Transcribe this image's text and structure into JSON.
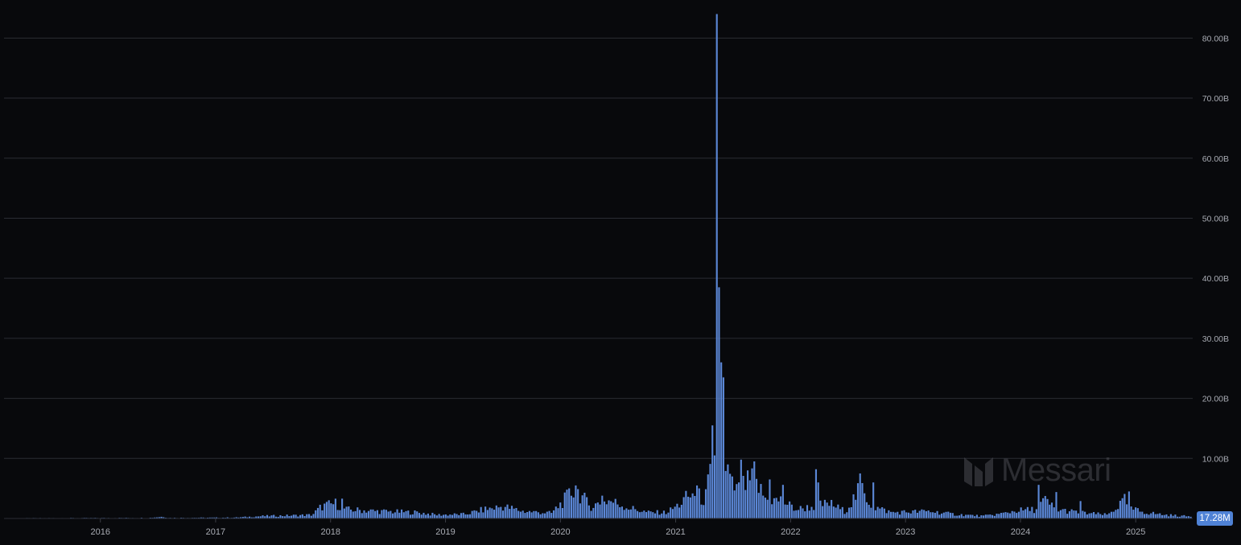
{
  "watermark": {
    "text": "Messari",
    "icon": "messari-logo-icon"
  },
  "last_value_label": "17.28M",
  "colors": {
    "background": "#08090c",
    "bar": "#5b87d6",
    "grid": "#2a2c33",
    "axis_text": "#a9acb4",
    "badge": "#4f82d6"
  },
  "chart_data": {
    "type": "bar",
    "title": "",
    "xlabel": "",
    "ylabel": "",
    "ylim": [
      0,
      85000000000
    ],
    "y_ticks": [
      10000000000,
      20000000000,
      30000000000,
      40000000000,
      50000000000,
      60000000000,
      70000000000,
      80000000000
    ],
    "y_tick_labels": [
      "10.00B",
      "20.00B",
      "30.00B",
      "40.00B",
      "50.00B",
      "60.00B",
      "70.00B",
      "80.00B"
    ],
    "x_range": [
      "2015-03-01",
      "2025-07-01"
    ],
    "x_ticks": [
      "2016-01-01",
      "2017-01-01",
      "2018-01-01",
      "2019-01-01",
      "2020-01-01",
      "2021-01-01",
      "2022-01-01",
      "2023-01-01",
      "2024-01-01",
      "2025-01-01"
    ],
    "x_tick_labels": [
      "2016",
      "2017",
      "2018",
      "2019",
      "2020",
      "2021",
      "2022",
      "2023",
      "2024",
      "2025"
    ],
    "grid": true,
    "legend": "none",
    "bar_interval": "weekly",
    "anchors": [
      [
        "2015-03-01",
        0.05
      ],
      [
        "2016-06-01",
        0.1
      ],
      [
        "2016-07-15",
        0.3
      ],
      [
        "2016-08-01",
        0.1
      ],
      [
        "2017-03-01",
        0.15
      ],
      [
        "2017-06-01",
        0.4
      ],
      [
        "2017-09-01",
        0.5
      ],
      [
        "2017-11-01",
        0.6
      ],
      [
        "2017-12-01",
        2.0
      ],
      [
        "2018-01-15",
        2.5
      ],
      [
        "2018-02-15",
        1.5
      ],
      [
        "2018-06-01",
        1.2
      ],
      [
        "2018-10-01",
        1.0
      ],
      [
        "2018-12-01",
        0.6
      ],
      [
        "2019-03-01",
        0.7
      ],
      [
        "2019-05-01",
        1.5
      ],
      [
        "2019-07-01",
        2.0
      ],
      [
        "2019-09-01",
        1.2
      ],
      [
        "2019-12-01",
        0.9
      ],
      [
        "2020-01-10",
        3.0
      ],
      [
        "2020-02-15",
        5.0
      ],
      [
        "2020-04-01",
        2.0
      ],
      [
        "2020-06-01",
        3.0
      ],
      [
        "2020-08-01",
        1.8
      ],
      [
        "2020-10-01",
        1.0
      ],
      [
        "2020-12-01",
        1.0
      ],
      [
        "2021-01-15",
        2.5
      ],
      [
        "2021-02-20",
        4.5
      ],
      [
        "2021-04-01",
        3.0
      ],
      [
        "2021-05-01",
        10.5
      ],
      [
        "2021-06-01",
        7.0
      ],
      [
        "2021-07-15",
        4.5
      ],
      [
        "2021-09-01",
        6.5
      ],
      [
        "2021-10-15",
        3.0
      ],
      [
        "2021-12-01",
        3.0
      ],
      [
        "2022-01-15",
        1.5
      ],
      [
        "2022-03-15",
        2.0
      ],
      [
        "2022-05-01",
        2.5
      ],
      [
        "2022-06-20",
        1.2
      ],
      [
        "2022-08-10",
        5.0
      ],
      [
        "2022-09-15",
        2.0
      ],
      [
        "2022-11-15",
        1.0
      ],
      [
        "2023-01-15",
        1.1
      ],
      [
        "2023-03-15",
        1.2
      ],
      [
        "2023-06-01",
        0.7
      ],
      [
        "2023-09-01",
        0.4
      ],
      [
        "2023-11-01",
        0.8
      ],
      [
        "2023-12-15",
        1.3
      ],
      [
        "2024-02-15",
        1.5
      ],
      [
        "2024-03-15",
        3.0
      ],
      [
        "2024-04-20",
        1.5
      ],
      [
        "2024-07-01",
        1.0
      ],
      [
        "2024-10-01",
        0.6
      ],
      [
        "2024-11-25",
        3.0
      ],
      [
        "2024-12-20",
        1.5
      ],
      [
        "2025-02-01",
        1.0
      ],
      [
        "2025-04-01",
        0.6
      ],
      [
        "2025-07-01",
        0.3
      ]
    ],
    "spikes": [
      [
        "2021-04-25",
        15.5
      ],
      [
        "2021-05-02",
        10.5
      ],
      [
        "2021-05-09",
        84.0
      ],
      [
        "2021-05-16",
        38.5
      ],
      [
        "2021-05-23",
        26.0
      ],
      [
        "2021-05-30",
        23.5
      ],
      [
        "2021-06-13",
        9.0
      ],
      [
        "2021-06-27",
        7.0
      ],
      [
        "2021-07-25",
        9.8
      ],
      [
        "2021-09-05",
        9.5
      ],
      [
        "2021-10-24",
        6.5
      ],
      [
        "2021-12-05",
        5.6
      ],
      [
        "2022-03-20",
        8.2
      ],
      [
        "2022-03-27",
        6.0
      ],
      [
        "2022-08-07",
        7.5
      ],
      [
        "2022-09-18",
        6.0
      ],
      [
        "2021-03-07",
        5.5
      ],
      [
        "2020-02-16",
        5.5
      ],
      [
        "2020-05-10",
        3.8
      ],
      [
        "2018-02-04",
        3.3
      ],
      [
        "2024-02-25",
        5.6
      ],
      [
        "2024-04-21",
        4.4
      ],
      [
        "2024-07-07",
        2.9
      ],
      [
        "2024-12-08",
        4.5
      ],
      [
        "2021-02-14",
        3.5
      ]
    ],
    "last_value": 17280000,
    "units": "B"
  }
}
